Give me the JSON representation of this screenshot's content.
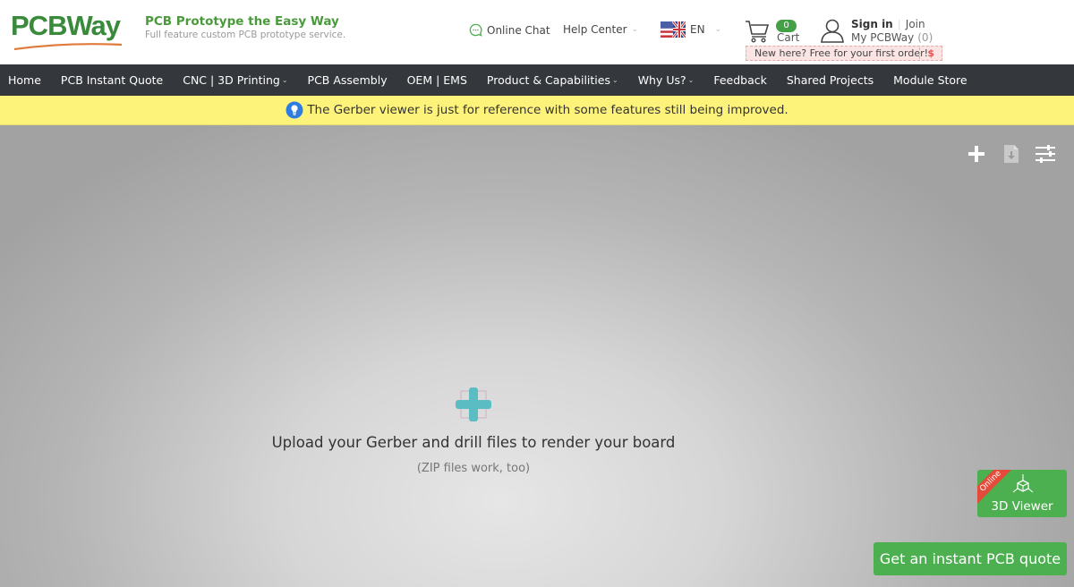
{
  "header": {
    "logo_text": "PCBWay",
    "tagline_title": "PCB Prototype the Easy Way",
    "tagline_sub": "Full feature custom PCB prototype service.",
    "online_chat": "Online Chat",
    "help_center": "Help Center",
    "language": "EN",
    "cart_count": "0",
    "cart_label": "Cart",
    "sign_in": "Sign in",
    "join": "Join",
    "my_account": "My PCBWay",
    "my_account_count": "(0)",
    "promo_text": "New here? Free for your first order!",
    "promo_symbol": "$"
  },
  "nav": {
    "items": [
      {
        "label": "Home",
        "dropdown": false
      },
      {
        "label": "PCB Instant Quote",
        "dropdown": false
      },
      {
        "label": "CNC | 3D Printing",
        "dropdown": true
      },
      {
        "label": "PCB Assembly",
        "dropdown": false
      },
      {
        "label": "OEM | EMS",
        "dropdown": false
      },
      {
        "label": "Product & Capabilities",
        "dropdown": true
      },
      {
        "label": "Why Us?",
        "dropdown": true
      },
      {
        "label": "Feedback",
        "dropdown": false
      },
      {
        "label": "Shared Projects",
        "dropdown": false
      },
      {
        "label": "Module Store",
        "dropdown": false
      }
    ]
  },
  "notice": {
    "text": "The Gerber viewer is just for reference with some features still being improved."
  },
  "viewer": {
    "tools": [
      "add-icon",
      "download-file-icon",
      "settings-sliders-icon"
    ],
    "upload_text": "Upload your Gerber and drill files to render your board",
    "upload_sub": "(ZIP files work, too)",
    "viewer3d_badge": "Online",
    "viewer3d_label": "3D Viewer",
    "quote_button": "Get an instant PCB quote"
  },
  "colors": {
    "brand_green": "#3a8a3c",
    "button_green": "#4caf50",
    "nav_bg": "#34373b",
    "notice_bg": "#fdf37a",
    "upload_teal": "#5bbcc4"
  }
}
